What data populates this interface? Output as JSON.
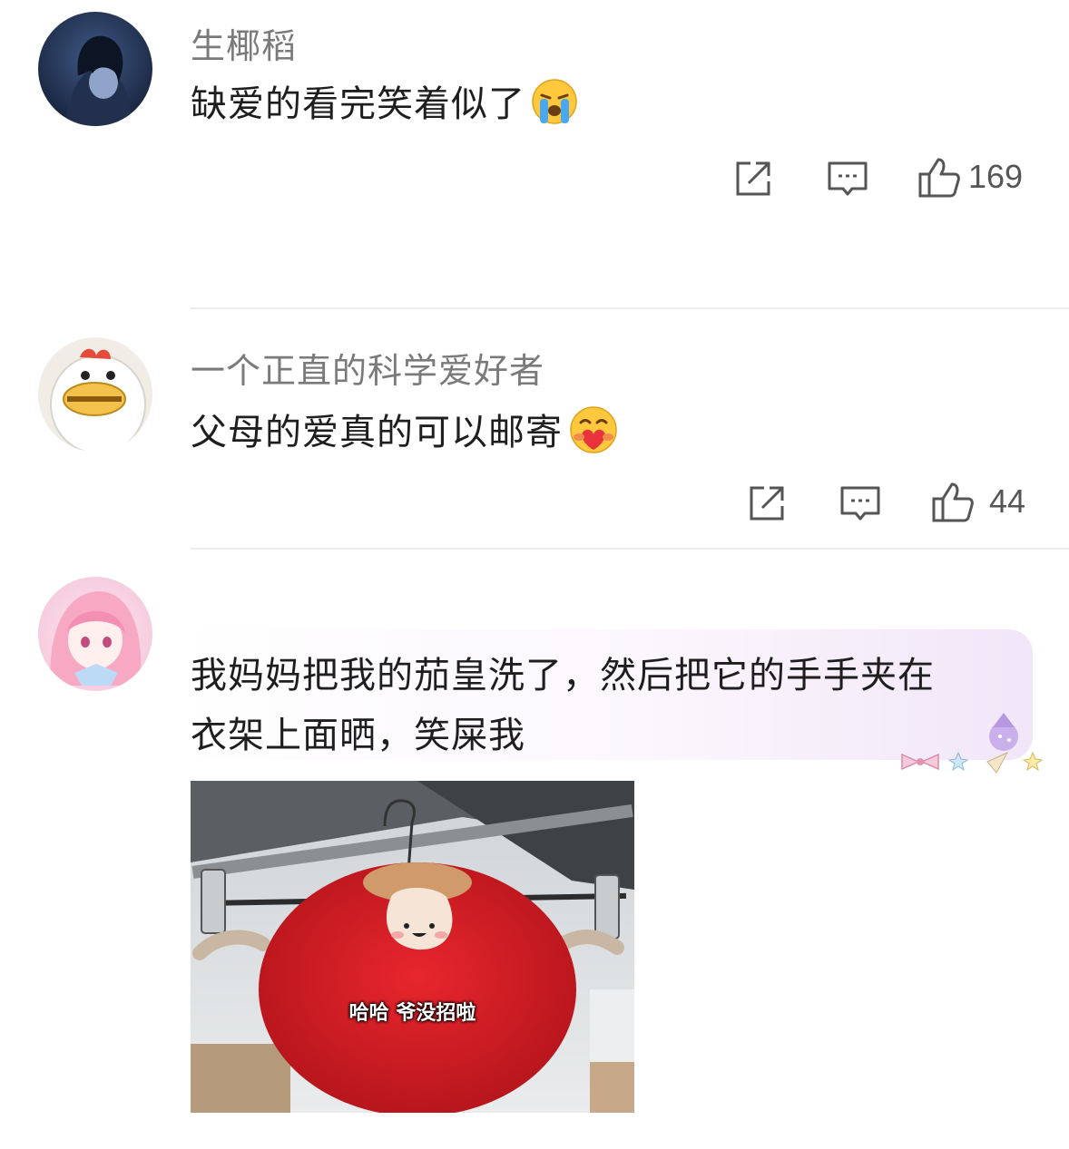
{
  "comments": [
    {
      "username": "生椰稻",
      "text": "缺爱的看完笑着似了",
      "emoji": "crying-face-emoji",
      "like_count": "169"
    },
    {
      "username": "一个正直的科学爱好者",
      "text": "父母的爱真的可以邮寄",
      "emoji": "heart-hug-face-emoji",
      "like_count": "44"
    },
    {
      "username": "",
      "text_line1": "我妈妈把我的茄皇洗了，然后把它的手手夹在",
      "text_line2": "衣架上面晒，笑屎我",
      "image_caption": "哈哈 爷没招啦"
    }
  ],
  "icons": {
    "share": "share-icon",
    "reply": "comment-icon",
    "like": "thumbs-up-icon"
  },
  "colors": {
    "username": "#7a7a7a",
    "text": "#1e1e1e",
    "icon": "#555555",
    "divider": "#ececec",
    "bubble_tint": "#f1e6f8"
  }
}
